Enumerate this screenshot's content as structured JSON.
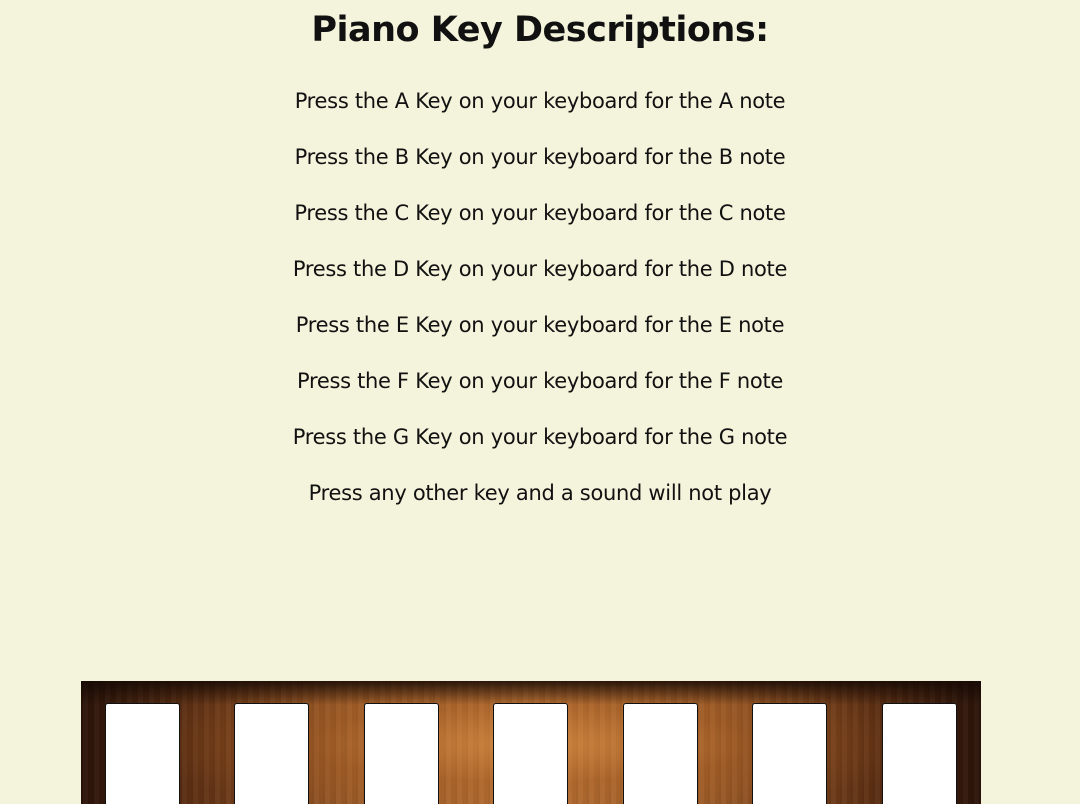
{
  "page": {
    "title": "Piano Key Descriptions:"
  },
  "descriptions": [
    "Press the A Key on your keyboard for the A note",
    "Press the B Key on your keyboard for the B note",
    "Press the C Key on your keyboard for the C note",
    "Press the D Key on your keyboard for the D note",
    "Press the E Key on your keyboard for the E note",
    "Press the F Key on your keyboard for the F note",
    "Press the G Key on your keyboard for the G note",
    "Press any other key and a sound will not play"
  ],
  "colors": {
    "background": "#f4f3dc",
    "text": "#111111",
    "key": "#ffffff",
    "wood": "#9a5a27"
  }
}
